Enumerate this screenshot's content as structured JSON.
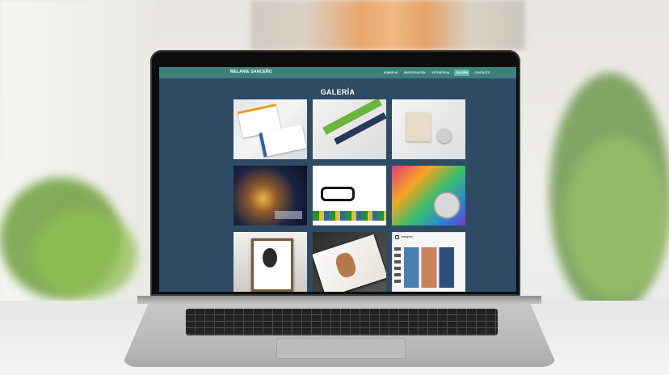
{
  "site": {
    "brand": "MELANIE SANCEÑO",
    "menu": [
      {
        "label": "SOBRE MÍ",
        "active": false
      },
      {
        "label": "INVESTIGACIÓN",
        "active": false
      },
      {
        "label": "ESTRATEGIA",
        "active": false
      },
      {
        "label": "GALERÍA",
        "active": true
      },
      {
        "label": "CONTACTO",
        "active": false
      }
    ],
    "gallery_title": "GALERÍA",
    "tiles": [
      {
        "label": "stationery-branding"
      },
      {
        "label": "letterhead-design"
      },
      {
        "label": "invitation-cards"
      },
      {
        "label": "night-city-postcards"
      },
      {
        "label": "glasses-and-cup-mockup"
      },
      {
        "label": "cd-packaging"
      },
      {
        "label": "framed-portrait-illustration"
      },
      {
        "label": "magazine-cover"
      },
      {
        "label": "instagram-profile"
      }
    ],
    "instagram_label": "Instagram"
  },
  "colors": {
    "nav": "#3d7f7b",
    "nav_active": "#5fb3a9",
    "page_bg": "#2e4b63"
  }
}
